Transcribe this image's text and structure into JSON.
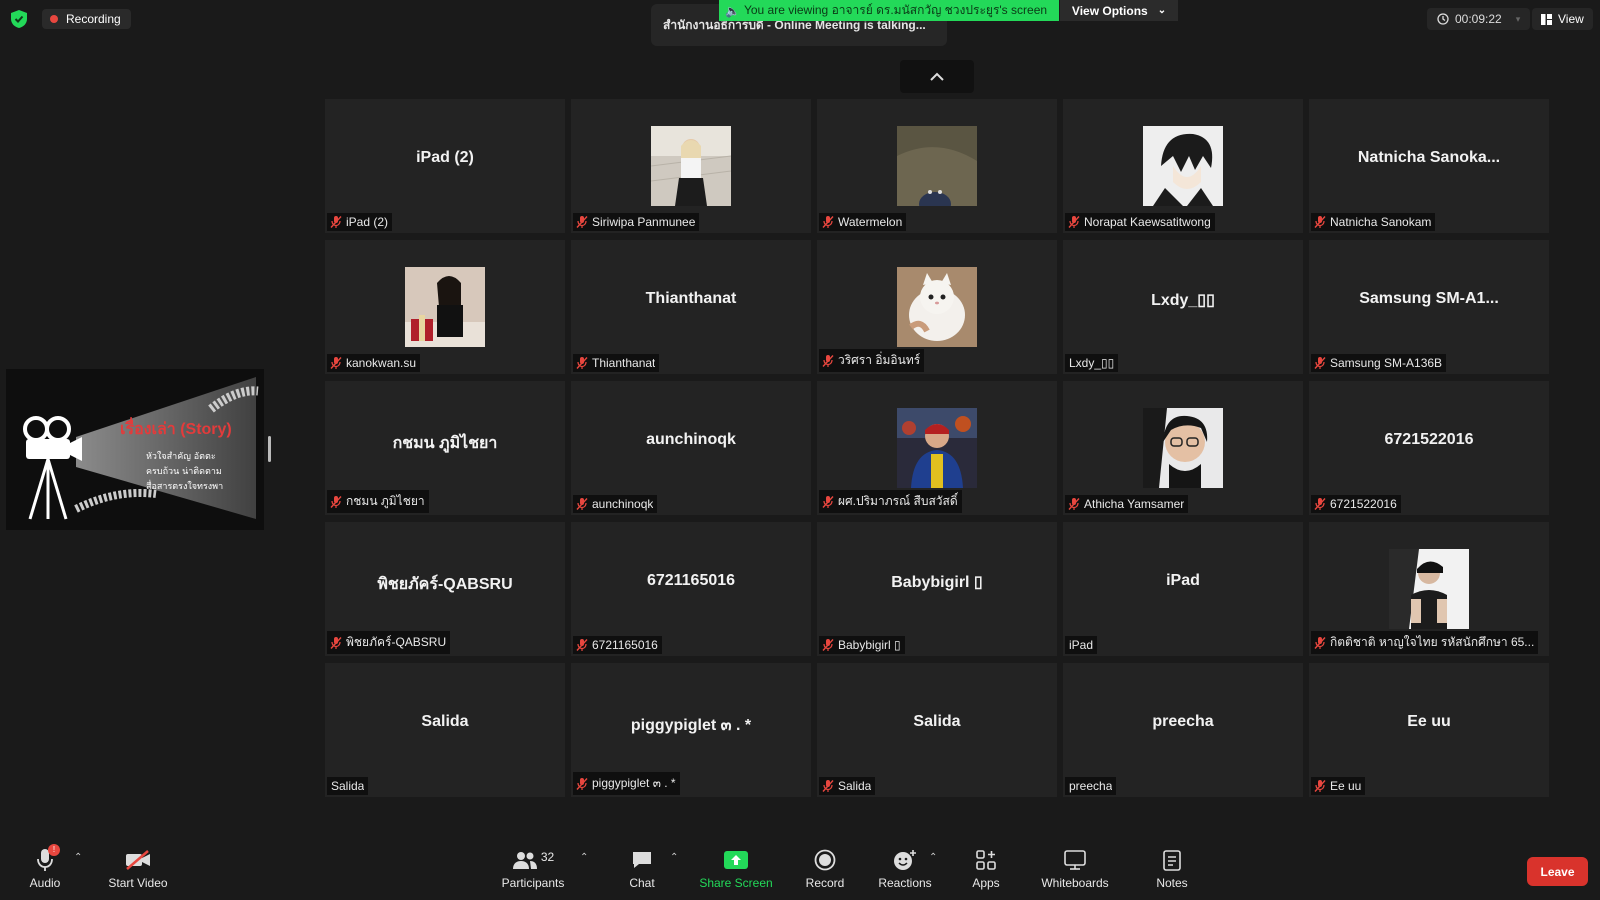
{
  "topbar": {
    "recording_label": "Recording",
    "meeting_title": "สำนักงานอธิการบดี - Online Meeting is talking...",
    "viewing_banner": "You are viewing อาจารย์ ดร.มนัสกวัญ ชวงประยูร's screen",
    "view_options_label": "View Options",
    "timer": "00:09:22",
    "view_label": "View"
  },
  "share_thumbnail": {
    "title": "เรื่องเล่า (Story)",
    "line1": "หัวใจสำคัญ  อัตตะ",
    "line2": "ครบถ้วน  น่าติดตาม",
    "line3": "สื่อสารตรงใจทรงพา"
  },
  "tiles": [
    {
      "display": "iPad (2)",
      "label": "iPad (2)",
      "muted": true,
      "photo": null
    },
    {
      "display": "",
      "label": "Siriwipa Panmunee",
      "muted": true,
      "photo": "woman-stairs"
    },
    {
      "display": "",
      "label": "Watermelon",
      "muted": true,
      "photo": "floor"
    },
    {
      "display": "",
      "label": "Norapat Kaewsatitwong",
      "muted": true,
      "photo": "anime"
    },
    {
      "display": "Natnicha  Sanoka...",
      "label": "Natnicha Sanokam",
      "muted": true,
      "photo": null
    },
    {
      "display": "",
      "label": "kanokwan.su",
      "muted": true,
      "photo": "woman-gift"
    },
    {
      "display": "Thianthanat",
      "label": "Thianthanat",
      "muted": true,
      "photo": null
    },
    {
      "display": "",
      "label": "วริศรา อิ่มอินทร์",
      "muted": true,
      "photo": "cat"
    },
    {
      "display": "Lxdy_▯▯",
      "label": "Lxdy_▯▯",
      "muted": false,
      "photo": null
    },
    {
      "display": "Samsung  SM-A1...",
      "label": "Samsung SM-A136B",
      "muted": true,
      "photo": null
    },
    {
      "display": "กชมน ภูมิไชยา",
      "label": "กชมน ภูมิไชยา",
      "muted": true,
      "photo": null
    },
    {
      "display": "aunchinoqk",
      "label": "aunchinoqk",
      "muted": true,
      "photo": null
    },
    {
      "display": "",
      "label": "ผศ.ปริมาภรณ์ สืบสวัสดิ์",
      "muted": true,
      "photo": "man-jacket"
    },
    {
      "display": "",
      "label": "Athicha Yamsamer",
      "muted": true,
      "photo": "girl-glasses"
    },
    {
      "display": "6721522016",
      "label": "6721522016",
      "muted": true,
      "photo": null
    },
    {
      "display": "พิชยภัคร์-QABSRU",
      "label": "พิชยภัคร์-QABSRU",
      "muted": true,
      "photo": null
    },
    {
      "display": "6721165016",
      "label": "6721165016",
      "muted": true,
      "photo": null
    },
    {
      "display": "Babybigirl ▯",
      "label": "Babybigirl ▯",
      "muted": true,
      "photo": null
    },
    {
      "display": "iPad",
      "label": "iPad",
      "muted": false,
      "photo": null
    },
    {
      "display": "",
      "label": "กิตติชาติ หาญใจไทย รหัสนักศึกษา 65...",
      "muted": true,
      "photo": "man-dark"
    },
    {
      "display": "Salida",
      "label": "Salida",
      "muted": false,
      "photo": null
    },
    {
      "display": "piggypiglet ๓ . *",
      "label": "piggypiglet ๓ . *",
      "muted": true,
      "photo": null
    },
    {
      "display": "Salida",
      "label": "Salida",
      "muted": true,
      "photo": null
    },
    {
      "display": "preecha",
      "label": "preecha",
      "muted": false,
      "photo": null
    },
    {
      "display": "Ee uu",
      "label": "Ee uu",
      "muted": true,
      "photo": null
    }
  ],
  "toolbar": {
    "audio_label": "Audio",
    "audio_badge": "!",
    "start_video_label": "Start Video",
    "participants_label": "Participants",
    "participants_count": "32",
    "chat_label": "Chat",
    "share_screen_label": "Share Screen",
    "record_label": "Record",
    "reactions_label": "Reactions",
    "apps_label": "Apps",
    "whiteboards_label": "Whiteboards",
    "notes_label": "Notes",
    "leave_label": "Leave"
  },
  "colors": {
    "accent_green": "#23d959",
    "leave_red": "#d9332c",
    "mute_red": "#e8473f",
    "tile_bg": "#232323"
  }
}
